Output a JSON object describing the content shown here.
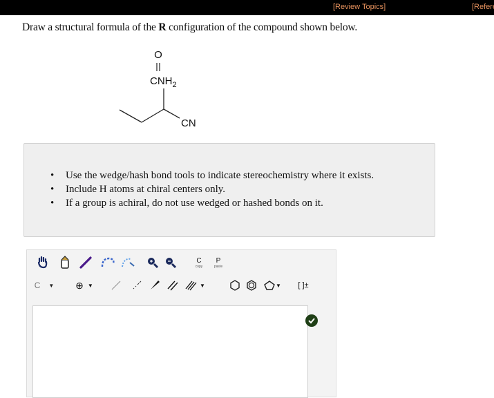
{
  "header": {
    "review_topics": "[Review Topics]",
    "references": "[References]"
  },
  "question": {
    "prefix": "Draw a structural formula of the ",
    "config": "R",
    "suffix": " configuration of the compound shown below."
  },
  "molecule": {
    "carbonyl_o": "O",
    "amide": "CNH2",
    "nitrile": "CN"
  },
  "instructions": [
    "Use the wedge/hash bond tools to indicate stereochemistry where it exists.",
    "Include H atoms at chiral centers only.",
    "If a group is achiral, do not use wedged or hashed bonds on it."
  ],
  "toolbar": {
    "row1": [
      "hand-tool-icon",
      "eraser-icon",
      "pencil-icon",
      "lasso-icon",
      "lasso-select-icon",
      "zoom-in-icon",
      "zoom-out-icon",
      "copy-icon",
      "paste-icon"
    ],
    "copy_label": "C",
    "copy_sub": "copy",
    "paste_label": "P",
    "paste_sub": "paste",
    "element_label": "C",
    "charge_label": "⊕",
    "bracket_label": "[ ]±"
  },
  "colors": {
    "topbar": "#000000",
    "link": "#e8935e",
    "editor_bg": "#f3f3f3",
    "ok_button": "#1f3f16"
  }
}
